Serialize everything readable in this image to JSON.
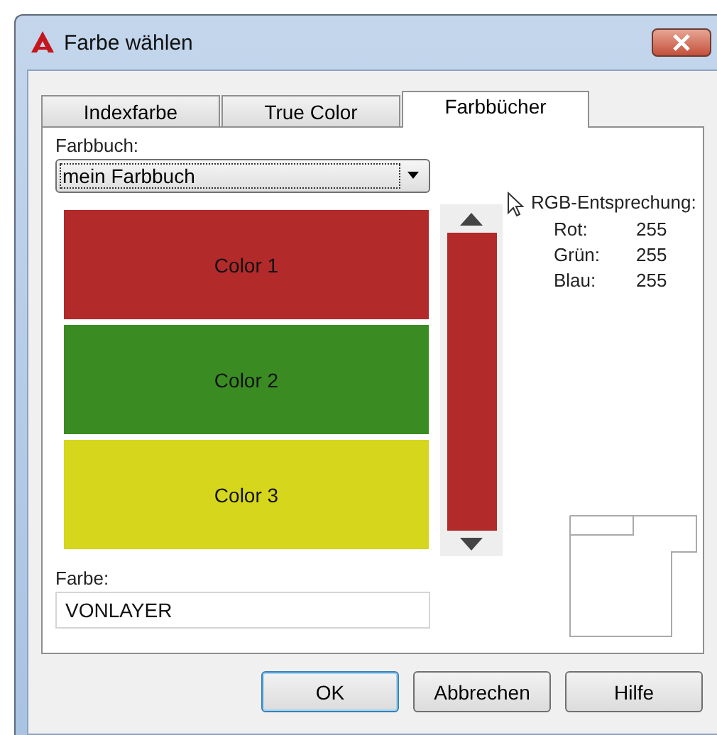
{
  "window": {
    "title": "Farbe wählen"
  },
  "tabs": [
    {
      "label": "Indexfarbe",
      "selected": false
    },
    {
      "label": "True Color",
      "selected": false
    },
    {
      "label": "Farbbücher",
      "selected": true
    }
  ],
  "color_book": {
    "label": "Farbbuch:",
    "value": "mein Farbbuch"
  },
  "swatches": [
    {
      "label": "Color 1",
      "color": "#b22a2a",
      "selected": false
    },
    {
      "label": "Color 2",
      "color": "#3a8c22",
      "selected": false
    },
    {
      "label": "Color 3",
      "color": "#d6d61c",
      "selected": false
    }
  ],
  "rgb": {
    "heading": "RGB-Entsprechung:",
    "rows": [
      {
        "label": "Rot:",
        "value": "255"
      },
      {
        "label": "Grün:",
        "value": "255"
      },
      {
        "label": "Blau:",
        "value": "255"
      }
    ]
  },
  "color_field": {
    "label": "Farbe:",
    "value": "VONLAYER"
  },
  "buttons": [
    {
      "label": "OK",
      "default": true
    },
    {
      "label": "Abbrechen",
      "default": false
    },
    {
      "label": "Hilfe",
      "default": false
    }
  ]
}
